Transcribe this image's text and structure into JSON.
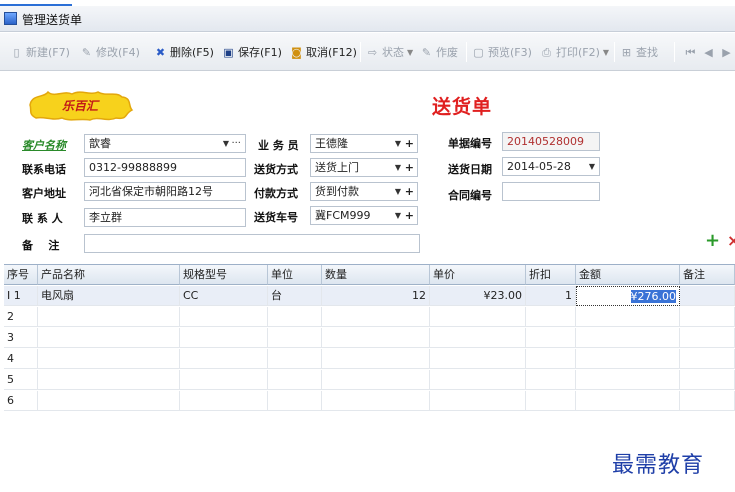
{
  "window": {
    "title": "管理送货单"
  },
  "toolbar": {
    "new": "新建(F7)",
    "edit": "修改(F4)",
    "delete": "删除(F5)",
    "save": "保存(F1)",
    "cancel": "取消(F12)",
    "status": "状态",
    "void": "作废",
    "preview": "预览(F3)",
    "print": "打印(F2)",
    "find": "查找"
  },
  "form": {
    "logo_text": "乐百汇",
    "doc_title": "送货单",
    "customer_name_label": "客户名称",
    "customer_name": "歆睿",
    "salesman_label": "业 务 员",
    "salesman": "王德隆",
    "doc_no_label": "单据编号",
    "doc_no": "20140528009",
    "phone_label": "联系电话",
    "phone": "0312-99888899",
    "delivery_method_label": "送货方式",
    "delivery_method": "送货上门",
    "delivery_date_label": "送货日期",
    "delivery_date": "2014-05-28",
    "address_label": "客户地址",
    "address": "河北省保定市朝阳路12号",
    "payment_method_label": "付款方式",
    "payment_method": "货到付款",
    "contract_no_label": "合同编号",
    "contract_no": "",
    "contact_label": "联 系 人",
    "contact": "李立群",
    "vehicle_label": "送货车号",
    "vehicle": "冀FCM999",
    "remark_label": "备    注",
    "remark": ""
  },
  "grid": {
    "columns": [
      "序号",
      "产品名称",
      "规格型号",
      "单位",
      "数量",
      "单价",
      "折扣",
      "金额",
      "备注"
    ],
    "rows": [
      {
        "seq": "I 1",
        "name": "电风扇",
        "spec": "CC",
        "unit": "台",
        "qty": "12",
        "price": "¥23.00",
        "discount": "1",
        "amount": "¥276.00",
        "remark": ""
      },
      {
        "seq": "2",
        "name": "",
        "spec": "",
        "unit": "",
        "qty": "",
        "price": "",
        "discount": "",
        "amount": "",
        "remark": ""
      },
      {
        "seq": "3",
        "name": "",
        "spec": "",
        "unit": "",
        "qty": "",
        "price": "",
        "discount": "",
        "amount": "",
        "remark": ""
      },
      {
        "seq": "4",
        "name": "",
        "spec": "",
        "unit": "",
        "qty": "",
        "price": "",
        "discount": "",
        "amount": "",
        "remark": ""
      },
      {
        "seq": "5",
        "name": "",
        "spec": "",
        "unit": "",
        "qty": "",
        "price": "",
        "discount": "",
        "amount": "",
        "remark": ""
      },
      {
        "seq": "6",
        "name": "",
        "spec": "",
        "unit": "",
        "qty": "",
        "price": "",
        "discount": "",
        "amount": "",
        "remark": ""
      }
    ]
  },
  "watermark": "最需教育",
  "colors": {
    "title_red": "#e02020",
    "link_green": "#2a8a2a",
    "selection_blue": "#3a73d6"
  }
}
